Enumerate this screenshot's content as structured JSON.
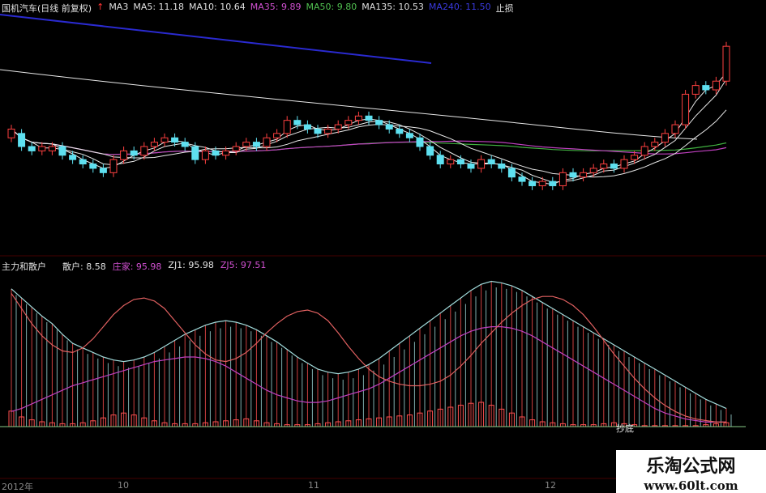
{
  "main_header": {
    "title": "国机汽车(日线 前复权)",
    "arrow_color": "#ff3333",
    "items": [
      {
        "label": "MA3",
        "color": "#e0e0e0"
      },
      {
        "label": "MA5: 11.18",
        "color": "#e0e0e0"
      },
      {
        "label": "MA10: 10.64",
        "color": "#e0e0e0"
      },
      {
        "label": "MA35: 9.89",
        "color": "#d050d0"
      },
      {
        "label": "MA50: 9.80",
        "color": "#50c050"
      },
      {
        "label": "MA135: 10.53",
        "color": "#e0e0e0"
      },
      {
        "label": "MA240: 11.50",
        "color": "#3a3adf"
      },
      {
        "label": "止损",
        "color": "#e0e0e0"
      }
    ]
  },
  "indicator_header": {
    "title": "主力和散户",
    "items": [
      {
        "label": "散户: 8.58",
        "color": "#e0e0e0"
      },
      {
        "label": "庄家: 95.98",
        "color": "#d050d0"
      },
      {
        "label": "ZJ1: 95.98",
        "color": "#e0e0e0"
      },
      {
        "label": "ZJ5: 97.51",
        "color": "#d050d0"
      }
    ]
  },
  "x_axis": {
    "labels": [
      "2012年",
      "10",
      "11",
      "12"
    ]
  },
  "annotation": {
    "label": "抄底"
  },
  "watermark": {
    "text": "乐淘公式网",
    "url": "www.60lt.com"
  },
  "colors": {
    "up": "#ff4040",
    "down": "#5ee0f0",
    "ma_white": "#e8e8e8",
    "ma35": "#c040c0",
    "ma50": "#40b040",
    "ma240": "#2a2ad0",
    "retail": "#a0dada",
    "maker": "#ff5050"
  },
  "chart_data": {
    "type": "candlestick",
    "y_range": [
      8.0,
      13.2
    ],
    "candles": [
      [
        10.41,
        10.61,
        10.31,
        10.71
      ],
      [
        10.51,
        10.21,
        10.11,
        10.61
      ],
      [
        10.21,
        10.11,
        10.01,
        10.31
      ],
      [
        10.11,
        10.21,
        10.01,
        10.31
      ],
      [
        10.11,
        10.21,
        10.01,
        10.31
      ],
      [
        10.21,
        10.01,
        9.91,
        10.31
      ],
      [
        10.01,
        9.91,
        9.81,
        10.11
      ],
      [
        9.91,
        9.81,
        9.71,
        10.01
      ],
      [
        9.81,
        9.71,
        9.61,
        9.91
      ],
      [
        9.71,
        9.61,
        9.51,
        9.81
      ],
      [
        9.61,
        9.91,
        9.51,
        10.01
      ],
      [
        9.91,
        10.11,
        9.81,
        10.21
      ],
      [
        10.11,
        10.01,
        9.91,
        10.21
      ],
      [
        10.01,
        10.21,
        9.91,
        10.31
      ],
      [
        10.21,
        10.31,
        10.11,
        10.41
      ],
      [
        10.31,
        10.41,
        10.21,
        10.51
      ],
      [
        10.41,
        10.31,
        10.21,
        10.51
      ],
      [
        10.31,
        10.21,
        10.11,
        10.41
      ],
      [
        10.21,
        9.91,
        9.81,
        10.31
      ],
      [
        9.91,
        10.11,
        9.81,
        10.21
      ],
      [
        10.11,
        10.01,
        9.91,
        10.21
      ],
      [
        10.01,
        10.11,
        9.91,
        10.21
      ],
      [
        10.11,
        10.21,
        10.01,
        10.31
      ],
      [
        10.21,
        10.31,
        10.11,
        10.41
      ],
      [
        10.31,
        10.21,
        10.11,
        10.41
      ],
      [
        10.21,
        10.41,
        10.11,
        10.51
      ],
      [
        10.41,
        10.51,
        10.31,
        10.61
      ],
      [
        10.51,
        10.81,
        10.41,
        10.91
      ],
      [
        10.81,
        10.71,
        10.61,
        10.91
      ],
      [
        10.71,
        10.61,
        10.51,
        10.81
      ],
      [
        10.61,
        10.51,
        10.41,
        10.71
      ],
      [
        10.51,
        10.61,
        10.41,
        10.71
      ],
      [
        10.61,
        10.71,
        10.51,
        10.81
      ],
      [
        10.71,
        10.81,
        10.61,
        10.91
      ],
      [
        10.81,
        10.91,
        10.71,
        11.01
      ],
      [
        10.91,
        10.81,
        10.71,
        11.01
      ],
      [
        10.81,
        10.71,
        10.61,
        10.91
      ],
      [
        10.71,
        10.61,
        10.51,
        10.81
      ],
      [
        10.61,
        10.51,
        10.41,
        10.71
      ],
      [
        10.51,
        10.41,
        10.31,
        10.61
      ],
      [
        10.41,
        10.21,
        10.11,
        10.51
      ],
      [
        10.21,
        10.01,
        9.91,
        10.31
      ],
      [
        10.01,
        9.81,
        9.71,
        10.11
      ],
      [
        9.81,
        9.91,
        9.71,
        10.01
      ],
      [
        9.91,
        9.81,
        9.71,
        10.01
      ],
      [
        9.81,
        9.71,
        9.61,
        9.91
      ],
      [
        9.71,
        9.91,
        9.61,
        10.01
      ],
      [
        9.91,
        9.81,
        9.71,
        10.01
      ],
      [
        9.81,
        9.71,
        9.61,
        9.91
      ],
      [
        9.71,
        9.51,
        9.41,
        9.81
      ],
      [
        9.51,
        9.41,
        9.31,
        9.61
      ],
      [
        9.41,
        9.31,
        9.21,
        9.51
      ],
      [
        9.31,
        9.41,
        9.21,
        9.51
      ],
      [
        9.41,
        9.31,
        9.21,
        9.51
      ],
      [
        9.31,
        9.61,
        9.21,
        9.71
      ],
      [
        9.61,
        9.51,
        9.41,
        9.71
      ],
      [
        9.51,
        9.61,
        9.41,
        9.71
      ],
      [
        9.61,
        9.71,
        9.51,
        9.81
      ],
      [
        9.71,
        9.81,
        9.61,
        9.91
      ],
      [
        9.81,
        9.71,
        9.61,
        9.91
      ],
      [
        9.71,
        9.91,
        9.61,
        10.01
      ],
      [
        9.91,
        10.01,
        9.81,
        10.11
      ],
      [
        10.01,
        10.21,
        9.91,
        10.31
      ],
      [
        10.21,
        10.31,
        10.11,
        10.41
      ],
      [
        10.31,
        10.51,
        10.21,
        10.61
      ],
      [
        10.51,
        10.71,
        10.41,
        10.81
      ],
      [
        10.71,
        11.41,
        10.61,
        11.51
      ],
      [
        11.41,
        11.61,
        11.31,
        11.71
      ],
      [
        11.61,
        11.51,
        11.41,
        11.71
      ],
      [
        11.51,
        11.71,
        11.41,
        11.81
      ],
      [
        11.71,
        12.51,
        11.61,
        12.61
      ]
    ],
    "retail": [
      91,
      85,
      79,
      73,
      68,
      61,
      55,
      52,
      49,
      46,
      44,
      43,
      44,
      46,
      49,
      53,
      57,
      61,
      64,
      67,
      69,
      70,
      69,
      67,
      64,
      60,
      56,
      51,
      46,
      42,
      38,
      36,
      35,
      36,
      38,
      41,
      45,
      50,
      55,
      60,
      65,
      70,
      75,
      80,
      85,
      90,
      94,
      96,
      95,
      93,
      90,
      86,
      82,
      78,
      74,
      70,
      66,
      62,
      58,
      54,
      50,
      46,
      42,
      38,
      34,
      30,
      26,
      22,
      18,
      15,
      12
    ],
    "maker": [
      10,
      12,
      15,
      18,
      21,
      24,
      27,
      29,
      31,
      33,
      35,
      37,
      39,
      41,
      43,
      44,
      45,
      46,
      46,
      45,
      43,
      40,
      36,
      32,
      28,
      24,
      21,
      19,
      17,
      16,
      16,
      17,
      19,
      21,
      23,
      25,
      28,
      32,
      36,
      40,
      44,
      48,
      52,
      56,
      60,
      63,
      65,
      66,
      66,
      65,
      63,
      60,
      56,
      52,
      48,
      44,
      40,
      36,
      32,
      28,
      24,
      20,
      16,
      12,
      9,
      7,
      5,
      4,
      3,
      3,
      3
    ],
    "zj_line": [
      88,
      78,
      68,
      60,
      54,
      50,
      49,
      52,
      58,
      66,
      74,
      80,
      84,
      85,
      83,
      78,
      70,
      62,
      54,
      48,
      44,
      43,
      45,
      49,
      55,
      62,
      68,
      73,
      76,
      77,
      75,
      70,
      62,
      53,
      45,
      38,
      33,
      30,
      28,
      27,
      27,
      28,
      30,
      34,
      40,
      47,
      55,
      62,
      69,
      75,
      80,
      84,
      86,
      86,
      84,
      80,
      74,
      66,
      57,
      48,
      40,
      32,
      25,
      19,
      14,
      10,
      7,
      5,
      4,
      3,
      3
    ],
    "bars": [
      16,
      10,
      7,
      5,
      4,
      3,
      3,
      4,
      6,
      9,
      12,
      14,
      12,
      9,
      6,
      4,
      3,
      3,
      3,
      4,
      5,
      6,
      7,
      8,
      6,
      4,
      3,
      2,
      2,
      2,
      3,
      4,
      5,
      6,
      7,
      8,
      9,
      10,
      11,
      12,
      14,
      16,
      18,
      20,
      22,
      24,
      25,
      22,
      18,
      14,
      10,
      7,
      5,
      4,
      3,
      2,
      2,
      2,
      3,
      4,
      3,
      2,
      1,
      1,
      1,
      1,
      1,
      1,
      2,
      3,
      4
    ],
    "annotation_index": 60
  }
}
